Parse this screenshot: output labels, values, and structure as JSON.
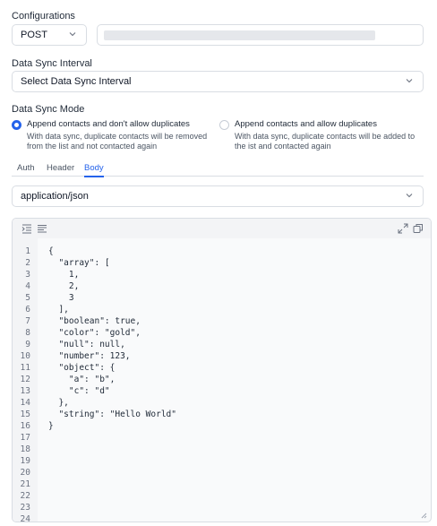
{
  "configurations": {
    "label": "Configurations",
    "method": "POST",
    "url_value": ""
  },
  "data_sync_interval": {
    "label": "Data Sync Interval",
    "placeholder": "Select Data Sync Interval"
  },
  "data_sync_mode": {
    "label": "Data Sync Mode",
    "options": [
      {
        "title": "Append contacts and don't allow duplicates",
        "desc_line1": "With data sync, duplicate contacts will be removed",
        "desc_line2": "from the list and not contacted again",
        "selected": true
      },
      {
        "title": "Append contacts and allow duplicates",
        "desc_line1": "With data sync, duplicate contacts will be added to",
        "desc_line2": "the ist and contacted again",
        "selected": false
      }
    ]
  },
  "tabs": [
    {
      "label": "Auth",
      "active": false
    },
    {
      "label": "Header",
      "active": false
    },
    {
      "label": "Body",
      "active": true
    }
  ],
  "content_type": {
    "value": "application/json"
  },
  "editor": {
    "line_numbers": [
      "1",
      "2",
      "3",
      "4",
      "5",
      "6",
      "7",
      "8",
      "9",
      "10",
      "11",
      "12",
      "13",
      "14",
      "15",
      "16",
      "17",
      "18",
      "19",
      "20",
      "21",
      "22",
      "23",
      "24"
    ],
    "lines": [
      "{",
      "  \"array\": [",
      "    1,",
      "    2,",
      "    3",
      "  ],",
      "  \"boolean\": true,",
      "  \"color\": \"gold\",",
      "  \"null\": null,",
      "  \"number\": 123,",
      "  \"object\": {",
      "    \"a\": \"b\",",
      "    \"c\": \"d\"",
      "  },",
      "  \"string\": \"Hello World\"",
      "}"
    ]
  },
  "colors": {
    "accent": "#2563eb",
    "border": "#d9dde3",
    "url_placeholder_bar": "#e5e7eb"
  },
  "icons": [
    "chevron-down-icon",
    "indent-icon",
    "format-lines-icon",
    "expand-icon",
    "copy-icon",
    "resize-handle-icon"
  ]
}
